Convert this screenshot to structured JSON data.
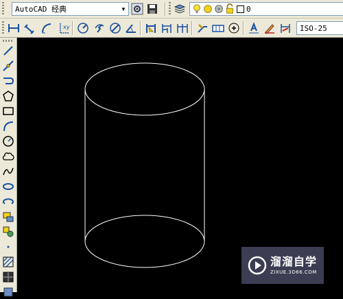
{
  "workspace": {
    "selected": "AutoCAD 经典"
  },
  "layer": {
    "current": "0"
  },
  "dim_style": {
    "selected": "ISO-25"
  },
  "watermark": {
    "title": "溜溜自学",
    "url": "ZIXUE.3D66.COM"
  },
  "colors": {
    "toolbar_bg": "#ece9d8",
    "canvas_bg": "#000000",
    "geometry": "#ffffff",
    "icon_blue": "#1a4fa0"
  }
}
